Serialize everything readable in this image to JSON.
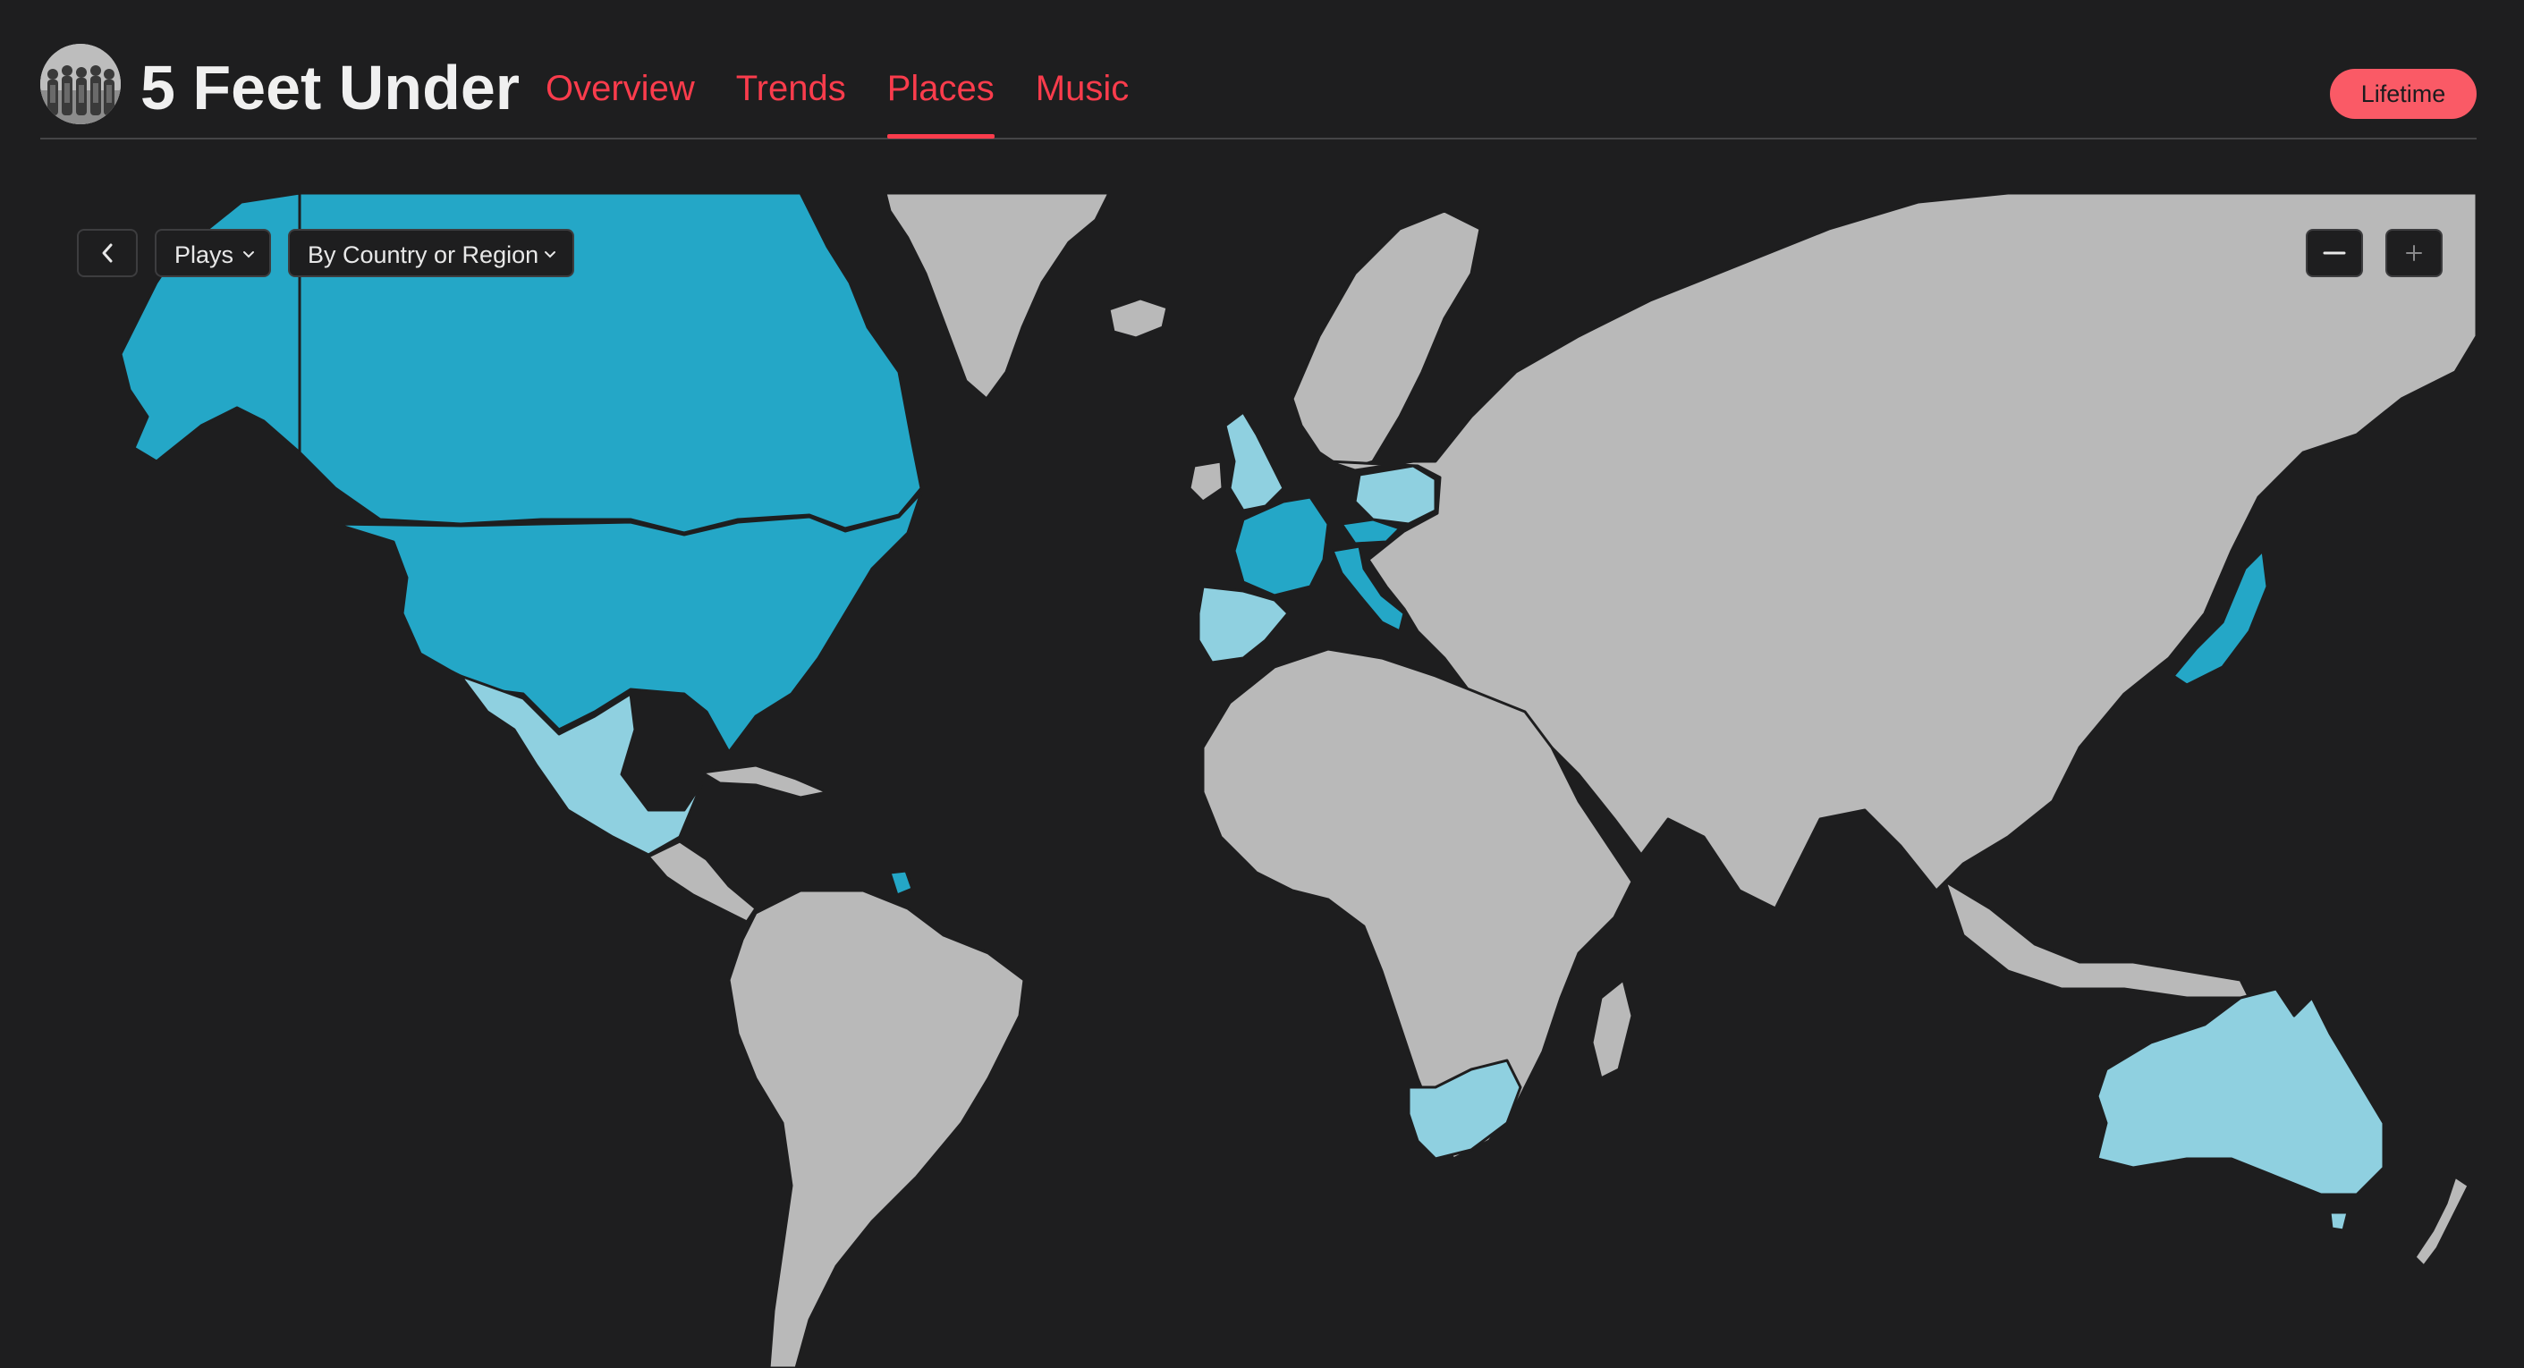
{
  "header": {
    "title": "5 Feet Under",
    "tabs": [
      {
        "label": "Overview",
        "active": false
      },
      {
        "label": "Trends",
        "active": false
      },
      {
        "label": "Places",
        "active": true
      },
      {
        "label": "Music",
        "active": false
      }
    ],
    "period_button": "Lifetime",
    "avatar_icon": "band-photo-avatar"
  },
  "map_controls": {
    "back_icon": "chevron-left-icon",
    "metric_label": "Plays",
    "grouping_label": "By Country or Region",
    "dropdown_icon": "chevron-down-icon",
    "zoom_out_icon": "minus-icon",
    "zoom_in_icon": "plus-icon"
  },
  "map": {
    "type": "choropleth",
    "metric": "Plays",
    "grouping": "By Country or Region",
    "colors": {
      "high": "#24a7c7",
      "low": "#8fd0e0",
      "no_data": "#b9b9b9",
      "water": "#1e1e1f"
    },
    "highlighted_regions": [
      {
        "name": "Canada",
        "level": "high"
      },
      {
        "name": "United States",
        "level": "high"
      },
      {
        "name": "France",
        "level": "high"
      },
      {
        "name": "Italy",
        "level": "high"
      },
      {
        "name": "Czechia",
        "level": "high"
      },
      {
        "name": "Japan",
        "level": "high"
      },
      {
        "name": "French Guiana",
        "level": "high"
      },
      {
        "name": "United Kingdom",
        "level": "low"
      },
      {
        "name": "Spain",
        "level": "low"
      },
      {
        "name": "Poland",
        "level": "low"
      },
      {
        "name": "Mexico",
        "level": "low"
      },
      {
        "name": "South Africa",
        "level": "low"
      },
      {
        "name": "Australia",
        "level": "low"
      }
    ]
  },
  "accent_color": "#fa3c4c"
}
